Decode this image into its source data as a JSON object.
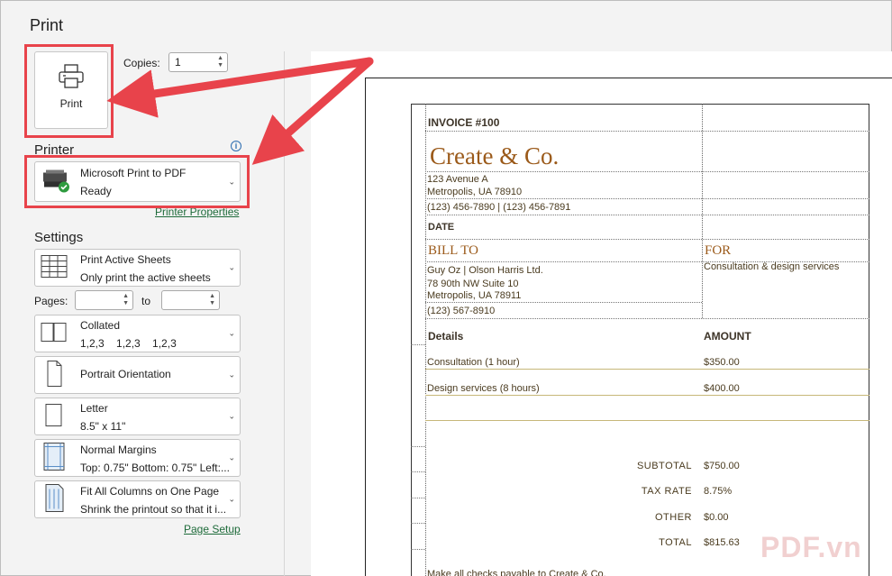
{
  "page": {
    "title": "Print"
  },
  "print_button": {
    "label": "Print"
  },
  "copies": {
    "label": "Copies:",
    "value": "1"
  },
  "printer": {
    "heading": "Printer",
    "name": "Microsoft Print to PDF",
    "status": "Ready",
    "properties_link": "Printer Properties"
  },
  "settings": {
    "heading": "Settings",
    "items": [
      {
        "line1": "Print Active Sheets",
        "line2": "Only print the active sheets",
        "icon": "sheets-grid-icon"
      },
      {
        "line1": "Collated",
        "line2": "1,2,3    1,2,3    1,2,3",
        "icon": "collated-icon"
      },
      {
        "line1": "Portrait Orientation",
        "line2": "",
        "icon": "portrait-page-icon"
      },
      {
        "line1": "Letter",
        "line2": "8.5\" x 11\"",
        "icon": "letter-page-icon"
      },
      {
        "line1": "Normal Margins",
        "line2": "Top: 0.75\" Bottom: 0.75\" Left:...",
        "icon": "margins-icon"
      },
      {
        "line1": "Fit All Columns on One Page",
        "line2": "Shrink the printout so that it i...",
        "icon": "fit-columns-icon"
      }
    ],
    "pages_label": "Pages:",
    "to_label": "to",
    "page_setup_link": "Page Setup"
  },
  "invoice": {
    "number": "INVOICE #100",
    "company": "Create & Co.",
    "address1": "123 Avenue A",
    "address2": "Metropolis, UA 78910",
    "phones": "(123) 456-7890 | (123) 456-7891",
    "date_label": "DATE",
    "bill_to_label": "BILL TO",
    "for_label": "FOR",
    "for_value": "Consultation & design services",
    "client_name": "Guy Oz | Olson Harris Ltd.",
    "client_addr1": "78 90th NW Suite 10",
    "client_addr2": "Metropolis, UA 78911",
    "client_phone": "(123) 567-8910",
    "details_header": "Details",
    "amount_header": "AMOUNT",
    "lines": [
      {
        "desc": "Consultation (1 hour)",
        "amount": "$350.00"
      },
      {
        "desc": "Design services (8 hours)",
        "amount": "$400.00"
      }
    ],
    "subtotal_label": "SUBTOTAL",
    "subtotal": "$750.00",
    "tax_label": "TAX RATE",
    "tax": "8.75%",
    "other_label": "OTHER",
    "other": "$0.00",
    "total_label": "TOTAL",
    "total": "$815.63",
    "footer": "Make all checks payable to Create & Co."
  },
  "watermark": "PDF.vn",
  "colors": {
    "annotation": "#e8434b",
    "link": "#1e6b3a",
    "company": "#9b5a1a"
  }
}
